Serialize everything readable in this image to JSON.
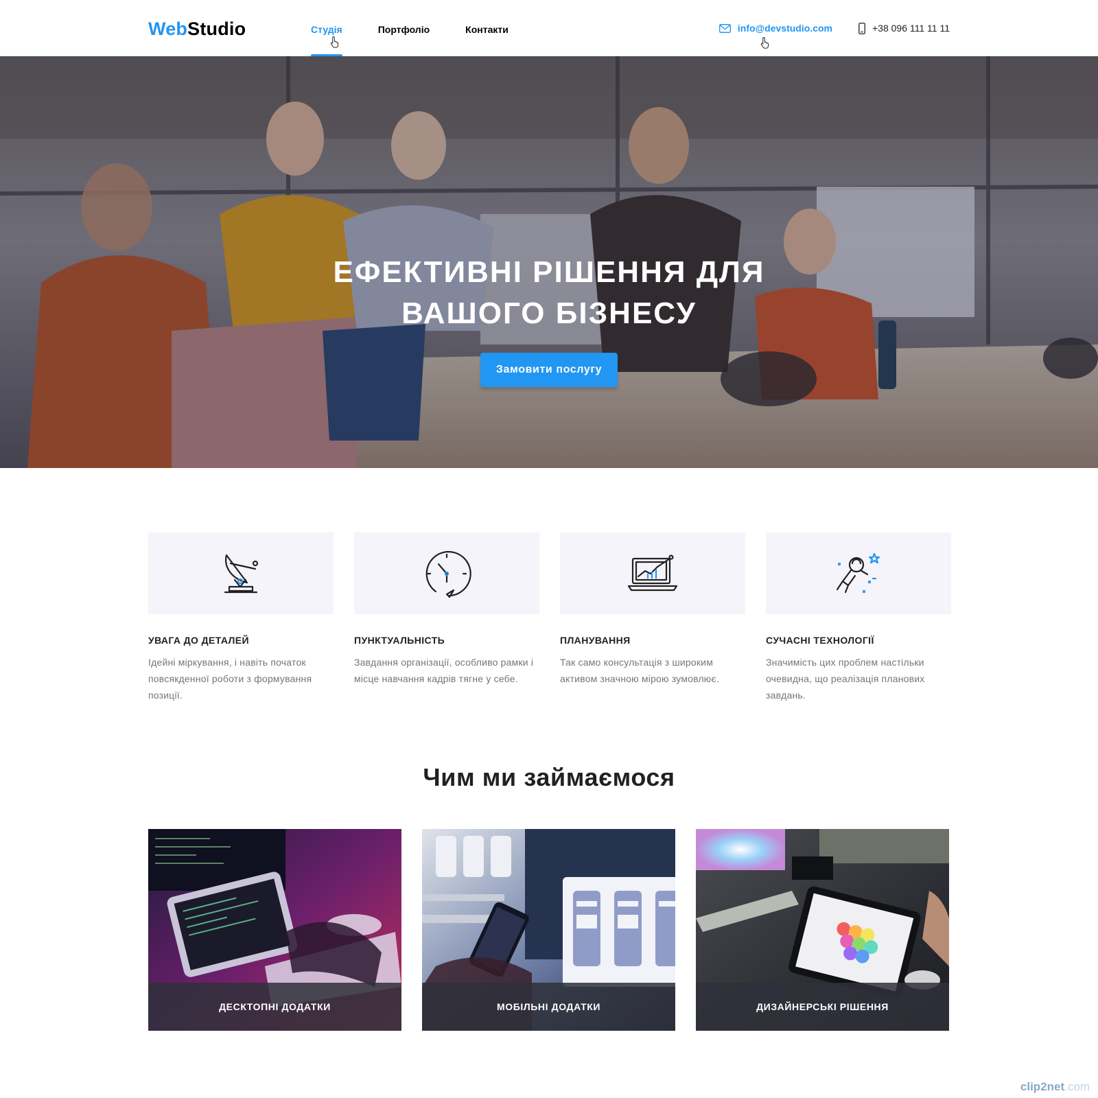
{
  "header": {
    "logo_part1": "Web",
    "logo_part2": "Studio",
    "nav": [
      {
        "label": "Студія",
        "active": true
      },
      {
        "label": "Портфоліо",
        "active": false
      },
      {
        "label": "Контакти",
        "active": false
      }
    ],
    "email": "info@devstudio.com",
    "phone": "+38 096 111 11 11"
  },
  "hero": {
    "title_line1": "Ефективні рішення для",
    "title_line2": "вашого бізнесу",
    "button": "Замовити послугу"
  },
  "features": [
    {
      "icon": "satellite-dish-icon",
      "title": "Увага до деталей",
      "text": "Ідейні міркування, і навіть початок повсякденної роботи з формування позиції."
    },
    {
      "icon": "clock-icon",
      "title": "Пунктуальність",
      "text": "Завдання організації, особливо рамки і місце навчання кадрів тягне у себе."
    },
    {
      "icon": "laptop-chart-icon",
      "title": "Планування",
      "text": "Так само консультація з широким активом значною мірою зумовлює."
    },
    {
      "icon": "astronaut-icon",
      "title": "Сучасні технології",
      "text": "Значимість цих проблем настільки очевидна, що реалізація планових завдань."
    }
  ],
  "section": {
    "title": "Чим ми займаємося",
    "cards": [
      {
        "label": "Десктопні додатки"
      },
      {
        "label": "Мобільні додатки"
      },
      {
        "label": "Дизайнерські рішення"
      }
    ]
  },
  "watermark": {
    "brand": "clip2net",
    "suffix": ".com"
  },
  "colors": {
    "accent": "#2196f3",
    "text": "#212121",
    "muted": "#757575",
    "feature_bg": "#f5f4fa"
  }
}
